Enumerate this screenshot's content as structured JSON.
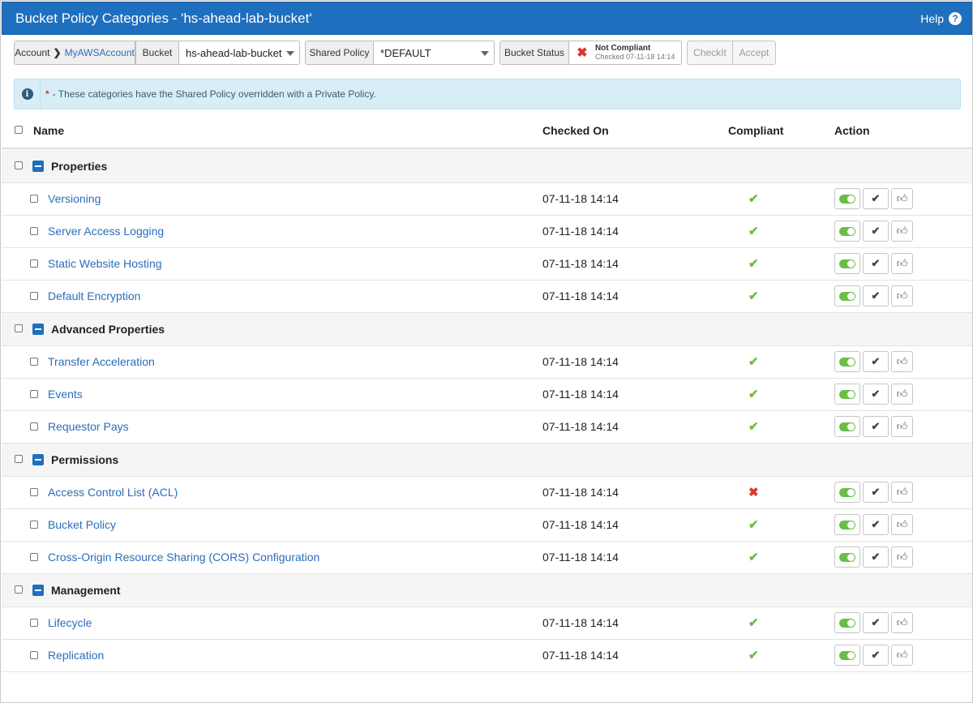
{
  "title": "Bucket Policy Categories - 'hs-ahead-lab-bucket'",
  "help_label": "Help",
  "toolbar": {
    "account_label": "Account",
    "account_value": "MyAWSAccount",
    "bucket_label": "Bucket",
    "bucket_value": "hs-ahead-lab-bucket",
    "shared_policy_label": "Shared Policy",
    "shared_policy_value": "*DEFAULT",
    "bucket_status_label": "Bucket Status",
    "status_main": "Not Compliant",
    "status_sub": "Checked 07-11-18 14:14",
    "checkit_label": "CheckIt",
    "accept_label": "Accept"
  },
  "info": {
    "star": "*",
    "text": "- These categories have the Shared Policy overridden with a Private Policy."
  },
  "columns": {
    "name": "Name",
    "checked_on": "Checked On",
    "compliant": "Compliant",
    "action": "Action"
  },
  "groups": [
    {
      "name": "Properties",
      "items": [
        {
          "name": "Versioning",
          "checked_on": "07-11-18 14:14",
          "compliant": true
        },
        {
          "name": "Server Access Logging",
          "checked_on": "07-11-18 14:14",
          "compliant": true
        },
        {
          "name": "Static Website Hosting",
          "checked_on": "07-11-18 14:14",
          "compliant": true
        },
        {
          "name": "Default Encryption",
          "checked_on": "07-11-18 14:14",
          "compliant": true
        }
      ]
    },
    {
      "name": "Advanced Properties",
      "items": [
        {
          "name": "Transfer Acceleration",
          "checked_on": "07-11-18 14:14",
          "compliant": true
        },
        {
          "name": "Events",
          "checked_on": "07-11-18 14:14",
          "compliant": true
        },
        {
          "name": "Requestor Pays",
          "checked_on": "07-11-18 14:14",
          "compliant": true
        }
      ]
    },
    {
      "name": "Permissions",
      "items": [
        {
          "name": "Access Control List (ACL)",
          "checked_on": "07-11-18 14:14",
          "compliant": false
        },
        {
          "name": "Bucket Policy",
          "checked_on": "07-11-18 14:14",
          "compliant": true
        },
        {
          "name": "Cross-Origin Resource Sharing (CORS) Configuration",
          "checked_on": "07-11-18 14:14",
          "compliant": true
        }
      ]
    },
    {
      "name": "Management",
      "items": [
        {
          "name": "Lifecycle",
          "checked_on": "07-11-18 14:14",
          "compliant": true
        },
        {
          "name": "Replication",
          "checked_on": "07-11-18 14:14",
          "compliant": true
        }
      ]
    }
  ],
  "icons": {
    "compliant_ok": "check-icon",
    "compliant_bad": "cross-icon",
    "actions": [
      "toggle-icon",
      "check-icon",
      "thumbs-up-icon"
    ]
  },
  "colors": {
    "header_blue": "#1f6fbf",
    "link_blue": "#2a6ebb",
    "ok_green": "#6bbd45",
    "error_red": "#d9382e",
    "info_bg": "#d9edf7"
  }
}
